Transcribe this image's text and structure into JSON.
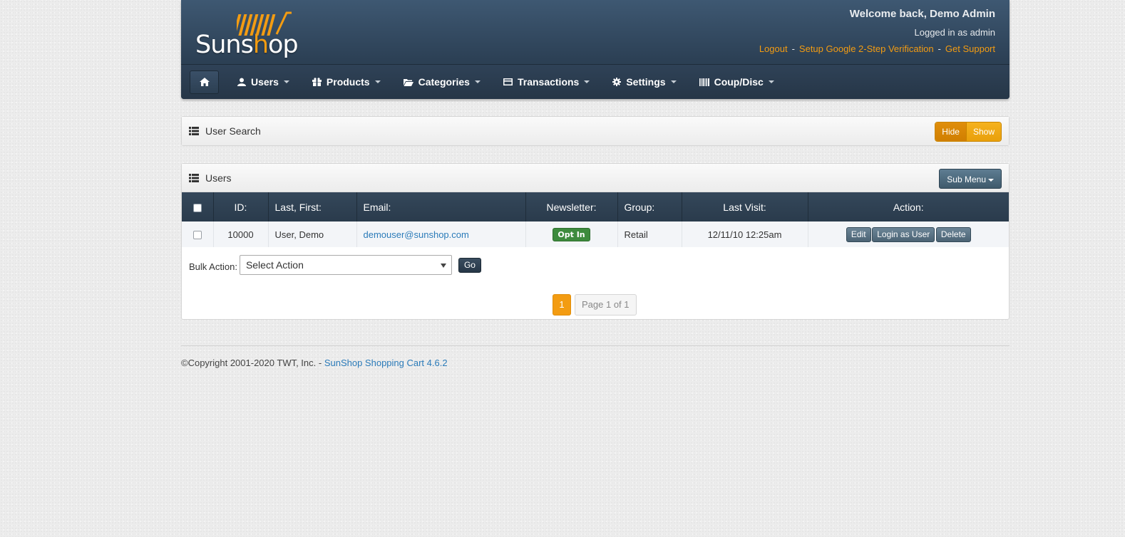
{
  "header": {
    "logo_text_pre": "Suns",
    "logo_text_o": "h",
    "logo_text_post": "op",
    "welcome": "Welcome back, Demo Admin",
    "logged_in": "Logged in as admin",
    "links": [
      "Logout",
      "Setup Google 2-Step Verification",
      "Get Support"
    ],
    "separator": "-"
  },
  "nav": {
    "items": [
      {
        "label": "Users",
        "icon": "user-icon"
      },
      {
        "label": "Products",
        "icon": "gift-icon"
      },
      {
        "label": "Categories",
        "icon": "folder-open-icon"
      },
      {
        "label": "Transactions",
        "icon": "credit-card-icon"
      },
      {
        "label": "Settings",
        "icon": "gear-icon"
      },
      {
        "label": "Coup/Disc",
        "icon": "barcode-icon"
      }
    ]
  },
  "search_panel": {
    "title": "User Search",
    "hide_label": "Hide",
    "show_label": "Show"
  },
  "users_panel": {
    "title": "Users",
    "submenu_label": "Sub Menu",
    "columns": [
      "ID:",
      "Last, First:",
      "Email:",
      "Newsletter:",
      "Group:",
      "Last Visit:",
      "Action:"
    ],
    "rows": [
      {
        "id": "10000",
        "name": "User, Demo",
        "email": "demouser@sunshop.com",
        "newsletter": "Opt In",
        "group": "Retail",
        "last_visit": "12/11/10 12:25am",
        "actions": [
          "Edit",
          "Login as User",
          "Delete"
        ]
      }
    ],
    "bulk_label": "Bulk Action:",
    "bulk_select": "Select Action",
    "go_label": "Go",
    "page_current": "1",
    "page_info": "Page 1 of 1"
  },
  "footer": {
    "copyright": "©Copyright 2001-2020 TWT, Inc. - ",
    "link": "SunShop Shopping Cart 4.6.2"
  },
  "colors": {
    "accent": "#f39c12",
    "header": "#2c4055",
    "link": "#2b7bb9",
    "optin": "#3d8b3d"
  }
}
